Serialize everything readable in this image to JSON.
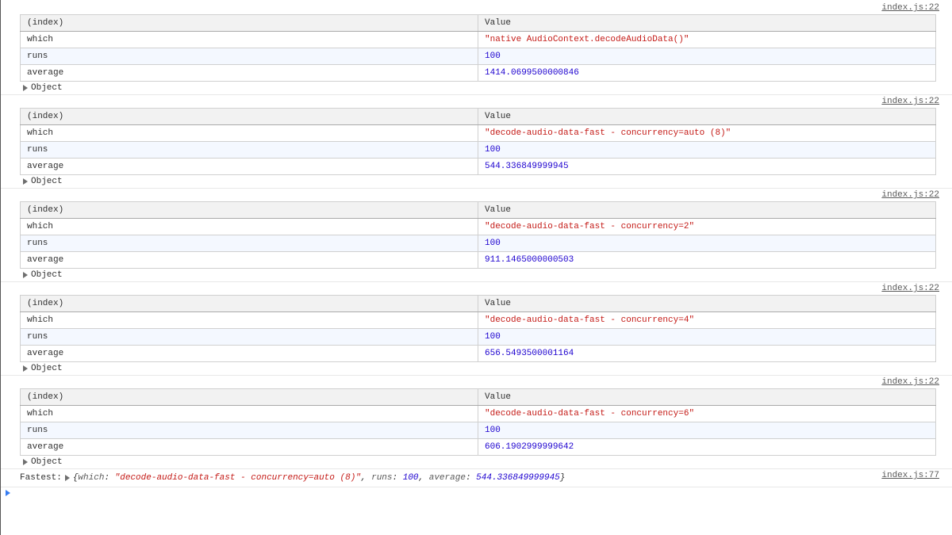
{
  "headers": {
    "index": "(index)",
    "value": "Value"
  },
  "object_label": "Object",
  "source_main": "index.js:22",
  "source_fastest": "index.js:77",
  "fastest_label": "Fastest: ",
  "fastest_keys": {
    "which": "which",
    "runs": "runs",
    "average": "average"
  },
  "tables": [
    {
      "rows": [
        {
          "k": "which",
          "v": "\"native AudioContext.decodeAudioData()\"",
          "t": "string"
        },
        {
          "k": "runs",
          "v": "100",
          "t": "number"
        },
        {
          "k": "average",
          "v": "1414.0699500000846",
          "t": "number"
        }
      ]
    },
    {
      "rows": [
        {
          "k": "which",
          "v": "\"decode-audio-data-fast - concurrency=auto (8)\"",
          "t": "string"
        },
        {
          "k": "runs",
          "v": "100",
          "t": "number"
        },
        {
          "k": "average",
          "v": "544.336849999945",
          "t": "number"
        }
      ]
    },
    {
      "rows": [
        {
          "k": "which",
          "v": "\"decode-audio-data-fast - concurrency=2\"",
          "t": "string"
        },
        {
          "k": "runs",
          "v": "100",
          "t": "number"
        },
        {
          "k": "average",
          "v": "911.1465000000503",
          "t": "number"
        }
      ]
    },
    {
      "rows": [
        {
          "k": "which",
          "v": "\"decode-audio-data-fast - concurrency=4\"",
          "t": "string"
        },
        {
          "k": "runs",
          "v": "100",
          "t": "number"
        },
        {
          "k": "average",
          "v": "656.5493500001164",
          "t": "number"
        }
      ]
    },
    {
      "rows": [
        {
          "k": "which",
          "v": "\"decode-audio-data-fast - concurrency=6\"",
          "t": "string"
        },
        {
          "k": "runs",
          "v": "100",
          "t": "number"
        },
        {
          "k": "average",
          "v": "606.1902999999642",
          "t": "number"
        }
      ]
    }
  ],
  "fastest": {
    "which": "\"decode-audio-data-fast - concurrency=auto (8)\"",
    "runs": "100",
    "average": "544.336849999945"
  }
}
